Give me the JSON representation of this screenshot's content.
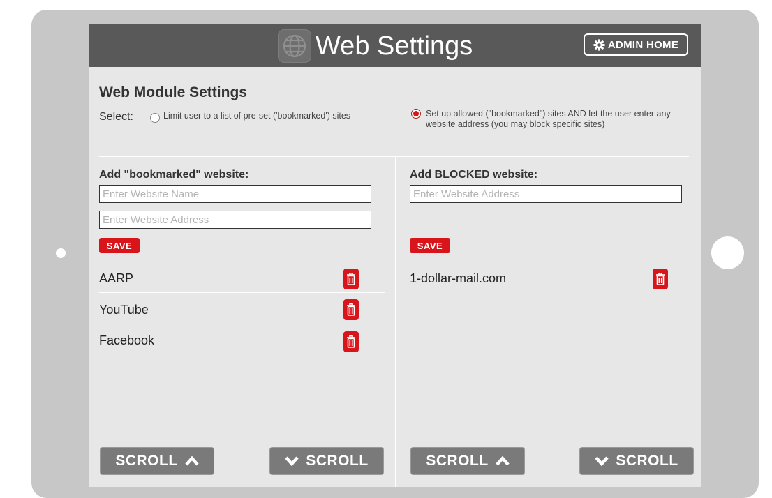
{
  "header": {
    "title": "Web Settings",
    "admin_button": "ADMIN HOME",
    "icons": {
      "logo": "globe-icon",
      "admin": "gear-icon"
    }
  },
  "settings": {
    "title": "Web Module Settings",
    "select_label": "Select:",
    "options": [
      {
        "text": "Limit user to a list of pre-set ('bookmarked') sites",
        "checked": false
      },
      {
        "text": "Set up allowed (\"bookmarked\") sites AND let the user enter any website address (you may block specific sites)",
        "checked": true
      }
    ]
  },
  "bookmarked": {
    "title": "Add \"bookmarked\" website:",
    "name_placeholder": "Enter Website Name",
    "address_placeholder": "Enter Website Address",
    "save_label": "SAVE",
    "items": [
      "AARP",
      "YouTube",
      "Facebook"
    ]
  },
  "blocked": {
    "title": "Add BLOCKED website:",
    "address_placeholder": "Enter Website Address",
    "save_label": "SAVE",
    "items": [
      "1-dollar-mail.com"
    ]
  },
  "scroll": {
    "label": "SCROLL",
    "icons": {
      "up": "chevron-up-icon",
      "down": "chevron-down-icon"
    }
  },
  "colors": {
    "accent_red": "#d8151b",
    "header_bg": "#595959",
    "screen_bg": "#e7e7e7",
    "frame": "#c7c7c7"
  }
}
